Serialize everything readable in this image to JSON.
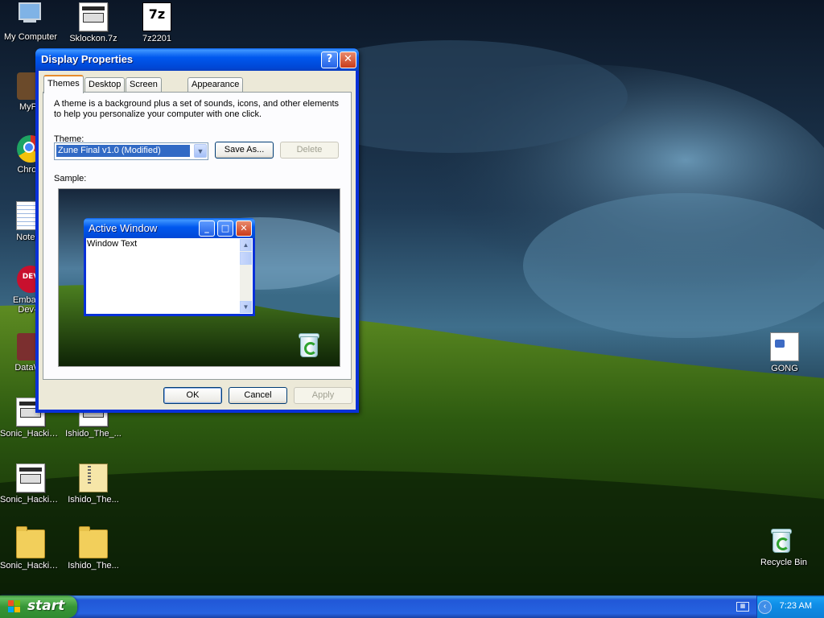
{
  "desktop": {
    "icons": [
      {
        "label": "My Computer",
        "icon": "my-computer-icon"
      },
      {
        "label": "Sklockon.7z",
        "icon": "archive-document-icon"
      },
      {
        "label": "7z2201",
        "icon": "7zip-icon"
      },
      {
        "label": "MyPa",
        "icon": "mypaint-icon"
      },
      {
        "label": "Chrom",
        "icon": "chrome-icon"
      },
      {
        "label": "Notepa",
        "icon": "notepad-icon"
      },
      {
        "label": "Embarca",
        "label2": "Dev-C",
        "icon": "devcpp-icon"
      },
      {
        "label": "DataWa",
        "icon": "datawatch-icon"
      },
      {
        "label": "Sonic_Hackin...",
        "icon": "document-icon"
      },
      {
        "label": "Ishido_The_...",
        "icon": "document-icon"
      },
      {
        "label": "Sonic_Hackin...",
        "icon": "document-icon"
      },
      {
        "label": "Ishido_The...",
        "icon": "zip-folder-icon"
      },
      {
        "label": "Sonic_Hackin...",
        "icon": "folder-icon"
      },
      {
        "label": "Ishido_The...",
        "icon": "folder-icon"
      },
      {
        "label": "GONG",
        "icon": "media-file-icon"
      },
      {
        "label": "Recycle Bin",
        "icon": "recycle-bin-icon"
      }
    ]
  },
  "dialog": {
    "title": "Display Properties",
    "help_glyph": "?",
    "close_glyph": "✕",
    "tabs": [
      {
        "label": "Themes",
        "active": true
      },
      {
        "label": "Desktop",
        "active": false
      },
      {
        "label": "Screen Saver",
        "active": false
      },
      {
        "label": "Appearance",
        "active": false
      }
    ],
    "description": "A theme is a background plus a set of sounds, icons, and other elements to help you personalize your computer with one click.",
    "theme_label": "Theme:",
    "theme_value": "Zune Final v1.0 (Modified)",
    "save_as_label": "Save As...",
    "delete_label": "Delete",
    "sample_label": "Sample:",
    "sample_window": {
      "title": "Active Window",
      "text": "Window Text"
    },
    "ok_label": "OK",
    "cancel_label": "Cancel",
    "apply_label": "Apply"
  },
  "taskbar": {
    "start_label": "start",
    "clock": "7:23 AM"
  },
  "colors": {
    "title_blue": "#0058ee",
    "selection": "#316ac5",
    "dialog_face": "#ece9d8",
    "start_green": "#379637"
  }
}
